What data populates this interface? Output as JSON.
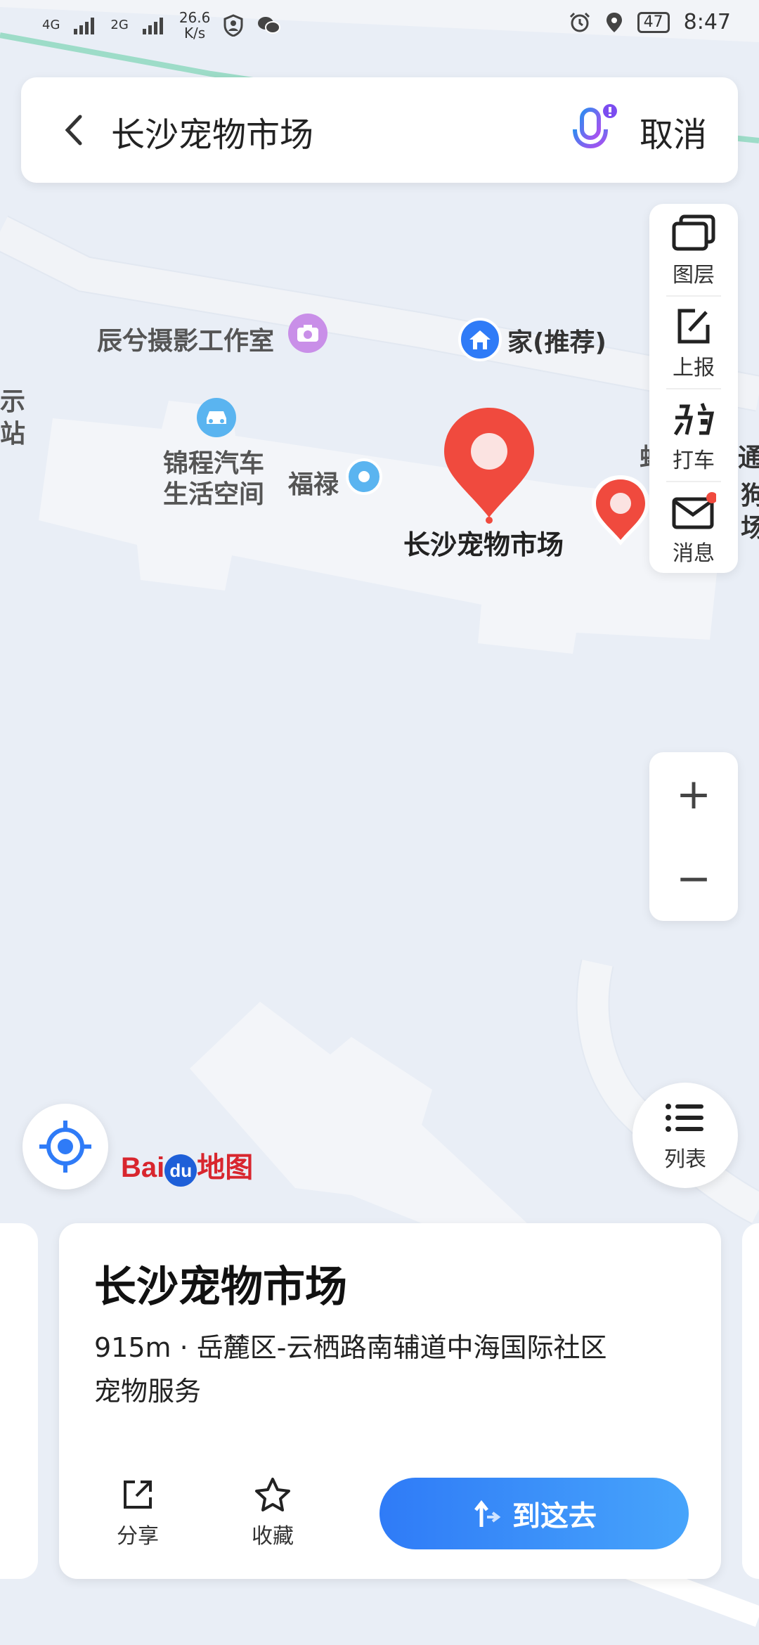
{
  "status_bar": {
    "signal1": "4G",
    "signal2": "2G",
    "net_speed": "26.6",
    "net_unit": "K/s",
    "battery": "47",
    "time": "8:47"
  },
  "search": {
    "query": "长沙宠物市场",
    "cancel_label": "取消"
  },
  "toolbar": {
    "layers_label": "图层",
    "report_label": "上报",
    "taxi_label": "打车",
    "messages_label": "消息"
  },
  "zoom": {
    "in": "+",
    "out": "−"
  },
  "map": {
    "poi_studio": "辰兮摄影工作室",
    "poi_home": "家(推荐)",
    "poi_car_line1": "锦程汽车",
    "poi_car_line2": "生活空间",
    "poi_fulu": "福禄",
    "poi_selected": "长沙宠物市场",
    "edge_left_1": "示",
    "edge_left_2": "站",
    "edge_right_1": "蚪",
    "edge_right_2": "通",
    "edge_right_3": "狗",
    "edge_right_4": "场"
  },
  "list_button": {
    "label": "列表"
  },
  "logo": {
    "bai": "Bai",
    "du": "du",
    "ditu": "地图"
  },
  "card": {
    "name": "长沙宠物市场",
    "address": "915m · 岳麓区-云栖路南辅道中海国际社区",
    "category": "宠物服务",
    "share_label": "分享",
    "favorite_label": "收藏",
    "go_label": "到这去"
  },
  "colors": {
    "accent": "#2f7bf7",
    "marker": "#f04a3e",
    "map_bg": "#e9eef6"
  }
}
